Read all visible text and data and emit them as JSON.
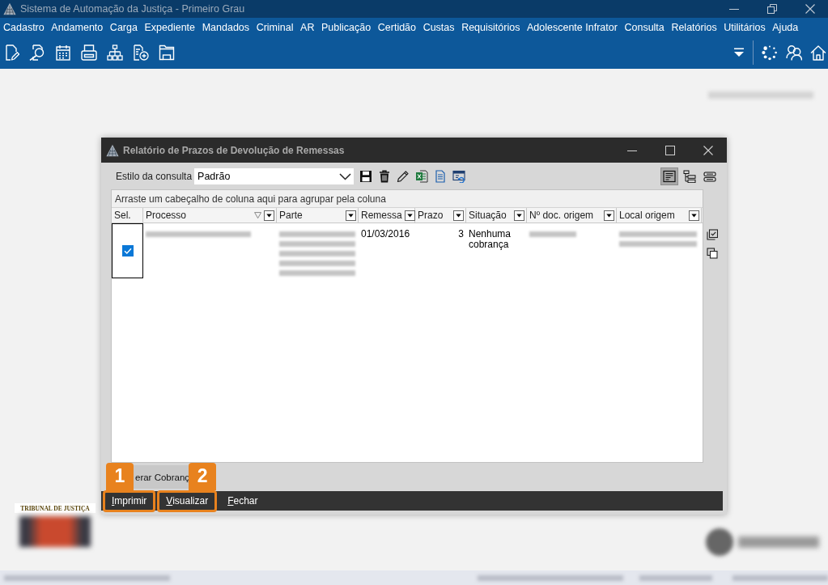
{
  "window": {
    "title": "Sistema de Automação da Justiça - Primeiro Grau"
  },
  "menu": [
    {
      "label": "Cadastro"
    },
    {
      "label": "Andamento"
    },
    {
      "label": "Carga"
    },
    {
      "label": "Expediente"
    },
    {
      "label": "Mandados"
    },
    {
      "label": "Criminal"
    },
    {
      "label": "AR"
    },
    {
      "label": "Publicação"
    },
    {
      "label": "Certidão"
    },
    {
      "label": "Custas"
    },
    {
      "label": "Requisitórios"
    },
    {
      "label": "Adolescente Infrator"
    },
    {
      "label": "Consulta"
    },
    {
      "label": "Relatórios"
    },
    {
      "label": "Utilitários"
    },
    {
      "label": "Ajuda"
    }
  ],
  "dialog": {
    "title": "Relatório de Prazos de Devolução de Remessas",
    "style_field": {
      "label": "Estilo da consulta",
      "value": "Padrão"
    },
    "view_modes": [
      {
        "selected": true
      },
      {
        "selected": false
      },
      {
        "selected": false
      }
    ],
    "grid": {
      "group_hint": "Arraste um cabeçalho de coluna aqui para agrupar pela coluna",
      "columns": [
        {
          "label": "Sel.",
          "dropdown": false,
          "sorted": false
        },
        {
          "label": "Processo",
          "dropdown": true,
          "sorted": true
        },
        {
          "label": "Parte",
          "dropdown": true,
          "sorted": false
        },
        {
          "label": "Remessa",
          "dropdown": true,
          "sorted": false
        },
        {
          "label": "Prazo",
          "dropdown": true,
          "sorted": false
        },
        {
          "label": "Situação",
          "dropdown": true,
          "sorted": false
        },
        {
          "label": "Nº doc. origem",
          "dropdown": true,
          "sorted": false
        },
        {
          "label": "Local origem",
          "dropdown": true,
          "sorted": false
        }
      ],
      "rows": [
        {
          "cells": [
            {
              "kind": "checkbox",
              "checked": true,
              "focused": true
            },
            {
              "kind": "redacted"
            },
            {
              "kind": "redacted"
            },
            {
              "kind": "text",
              "text": "01/03/2016"
            },
            {
              "kind": "number",
              "text": "3"
            },
            {
              "kind": "text",
              "text": "Nenhuma cobrança"
            },
            {
              "kind": "redacted"
            },
            {
              "kind": "redacted"
            }
          ]
        }
      ]
    },
    "partial_button": {
      "label": "erar Cobranç"
    },
    "footer_buttons": [
      {
        "label": "Imprimir",
        "highlighted": true,
        "callout": "1"
      },
      {
        "label": "Visualizar",
        "highlighted": true,
        "callout": "2"
      },
      {
        "label": "Fechar",
        "highlighted": false
      }
    ]
  },
  "logo": {
    "caption": "TRIBUNAL DE JUSTIÇA"
  }
}
